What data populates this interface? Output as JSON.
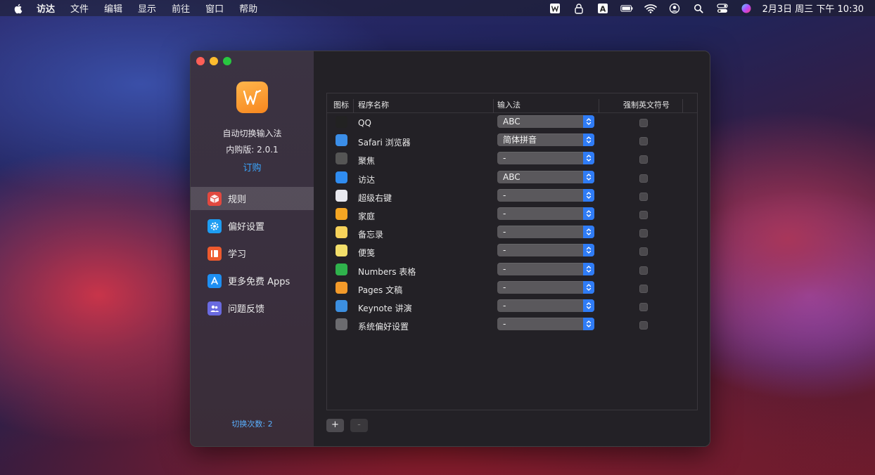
{
  "menubar": {
    "items": [
      "访达",
      "文件",
      "编辑",
      "显示",
      "前往",
      "窗口",
      "帮助"
    ],
    "clock": "2月3日 周三 下午 10:30",
    "status_icons": [
      "w-app-icon",
      "lock-icon",
      "input-a-icon",
      "battery-icon",
      "wifi-icon",
      "user-icon",
      "search-icon",
      "control-center-icon",
      "siri-icon"
    ]
  },
  "sidebar": {
    "app_name": "自动切换输入法",
    "version": "内购版: 2.0.1",
    "order": "订购",
    "nav": [
      {
        "label": "规则",
        "icon": "rules-icon",
        "color": "#e2483f"
      },
      {
        "label": "偏好设置",
        "icon": "gear-icon",
        "color": "#1e9df2"
      },
      {
        "label": "学习",
        "icon": "book-icon",
        "color": "#ee5a2e"
      },
      {
        "label": "更多免费 Apps",
        "icon": "app-store-icon",
        "color": "#1e8ff2"
      },
      {
        "label": "问题反馈",
        "icon": "people-icon",
        "color": "#6a6ae0"
      }
    ],
    "switch_count": "切换次数: 2"
  },
  "table": {
    "headers": {
      "icon": "图标",
      "name": "程序名称",
      "input": "输入法",
      "force": "强制英文符号"
    },
    "rows": [
      {
        "name": "QQ",
        "input": "ABC",
        "icon": "qq-icon",
        "color": "#222"
      },
      {
        "name": "Safari 浏览器",
        "input": "简体拼音",
        "icon": "safari-icon",
        "color": "#3b8ee8"
      },
      {
        "name": "聚焦",
        "input": "-",
        "icon": "spotlight-icon",
        "color": "#555"
      },
      {
        "name": "访达",
        "input": "ABC",
        "icon": "finder-icon",
        "color": "#2f8cf0"
      },
      {
        "name": "超级右键",
        "input": "-",
        "icon": "right-click-icon",
        "color": "#e9e9ef"
      },
      {
        "name": "家庭",
        "input": "-",
        "icon": "home-icon",
        "color": "#f5a623"
      },
      {
        "name": "备忘录",
        "input": "-",
        "icon": "notes-icon",
        "color": "#f7d25a"
      },
      {
        "name": "便笺",
        "input": "-",
        "icon": "stickies-icon",
        "color": "#f2de6a"
      },
      {
        "name": "Numbers 表格",
        "input": "-",
        "icon": "numbers-icon",
        "color": "#2fb24c"
      },
      {
        "name": "Pages 文稿",
        "input": "-",
        "icon": "pages-icon",
        "color": "#f39a2a"
      },
      {
        "name": "Keynote 讲演",
        "input": "-",
        "icon": "keynote-icon",
        "color": "#3c8fe0"
      },
      {
        "name": "系统偏好设置",
        "input": "-",
        "icon": "system-preferences-icon",
        "color": "#6b6b6f"
      }
    ]
  },
  "bottom": {
    "add": "+",
    "remove": "-"
  }
}
